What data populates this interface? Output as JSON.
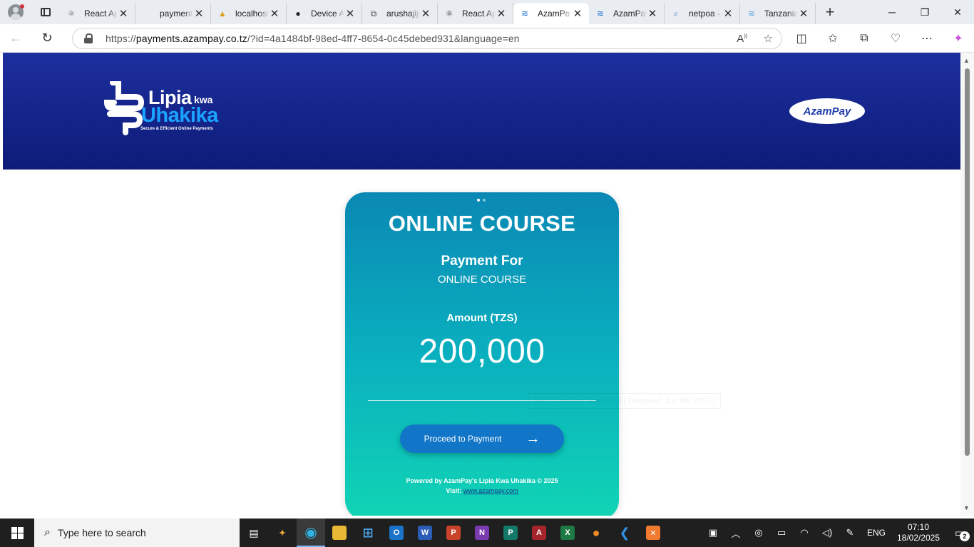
{
  "browser": {
    "tabs": [
      {
        "title": "React App",
        "icon": "react-icon",
        "active": false
      },
      {
        "title": "payments",
        "icon": "blank-icon",
        "active": false
      },
      {
        "title": "localhost",
        "icon": "pma-icon",
        "active": false
      },
      {
        "title": "Device A",
        "icon": "github-icon",
        "active": false
      },
      {
        "title": "arushajiji",
        "icon": "puzzle-icon",
        "active": false
      },
      {
        "title": "React App",
        "icon": "react-icon",
        "active": false
      },
      {
        "title": "AzamPay",
        "icon": "azampay-icon",
        "active": true
      },
      {
        "title": "AzamPay",
        "icon": "azampay-icon",
        "active": false
      },
      {
        "title": "netpoa -",
        "icon": "search-icon",
        "active": false
      },
      {
        "title": "Tanzania",
        "icon": "azampay-icon",
        "active": false
      }
    ],
    "url_scheme": "https://",
    "url_host": "payments.azampay.co.tz",
    "url_path": "/?id=4a1484bf-98ed-4ff7-8654-0c45debed931&language=en"
  },
  "header": {
    "logo_lipia": "Lipia",
    "logo_kwa": "kwa",
    "logo_uhakika": "Uhakika",
    "logo_tagline": "Secure & Efficient Online Payments",
    "azampay_logo": "AzamPay"
  },
  "card": {
    "title": "ONLINE COURSE",
    "payment_for_label": "Payment For",
    "payment_for_value": "ONLINE COURSE",
    "amount_label": "Amount (TZS)",
    "amount_value": "200,000",
    "proceed_label": "Proceed to Payment",
    "powered_by": "Powered by AzamPay's Lipia Kwa Uhakika © 2025",
    "visit_label": "Visit:",
    "visit_link": "www.azampay.com"
  },
  "overlay": {
    "text": "Mini Compiled from 2.2.4 | Compiled: Jun 5th 2019 |"
  },
  "taskbar": {
    "search_placeholder": "Type here to search",
    "language": "ENG",
    "time": "07:10",
    "date": "18/02/2025",
    "notification_count": "2"
  }
}
